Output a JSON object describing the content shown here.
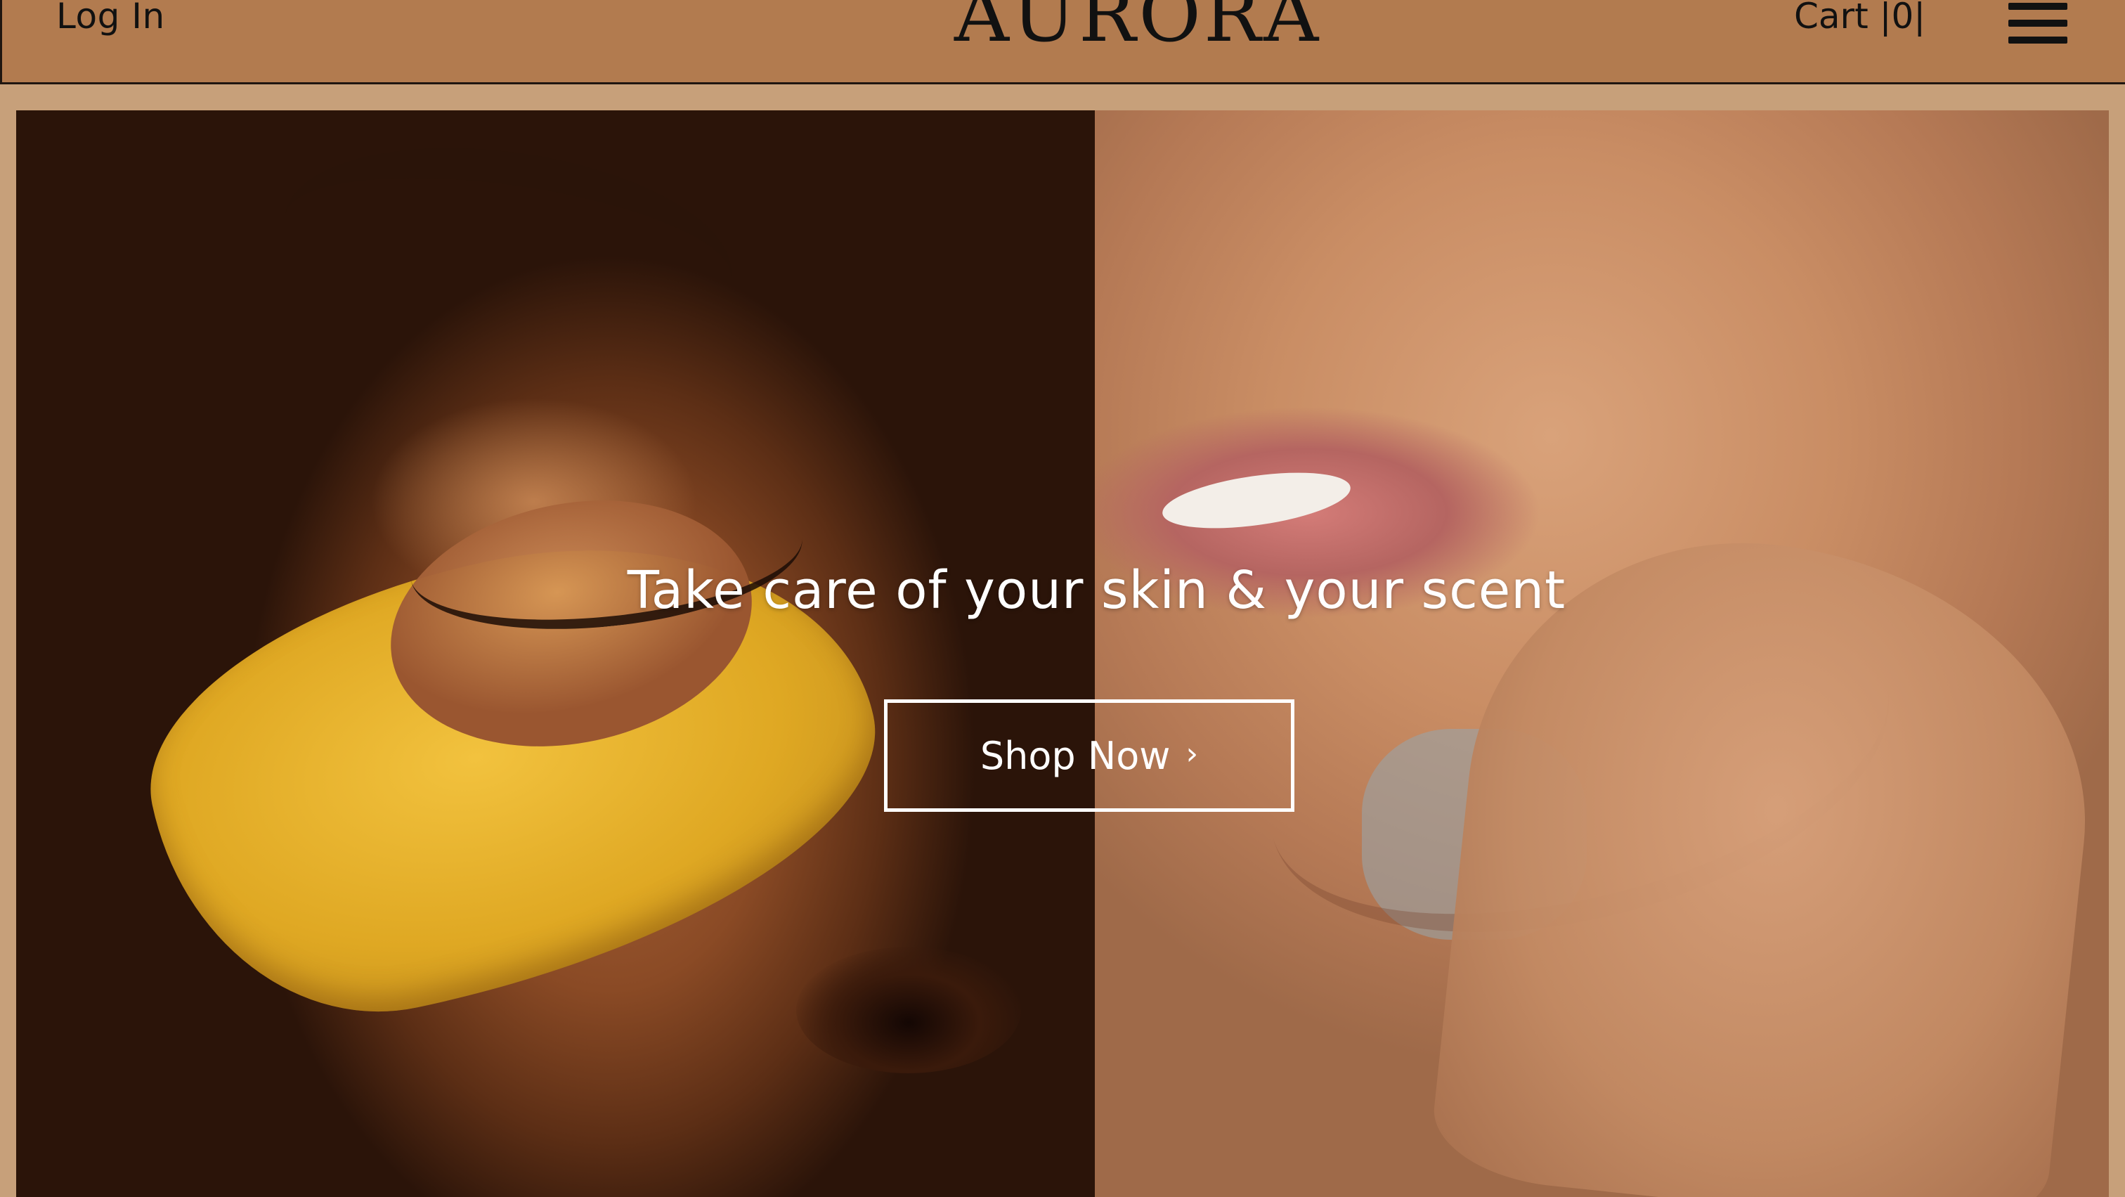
{
  "header": {
    "login_label": "Log In",
    "logo_text": "AURORA",
    "cart_label": "Cart |0|"
  },
  "hero": {
    "headline": "Take care of your skin & your scent",
    "cta_label": "Shop Now",
    "cta_icon": "chevron-right-icon"
  },
  "colors": {
    "header_bg": "#b27b4f",
    "page_bg": "#c7a07a",
    "text_dark": "#111111",
    "hero_text": "#ffffff"
  }
}
